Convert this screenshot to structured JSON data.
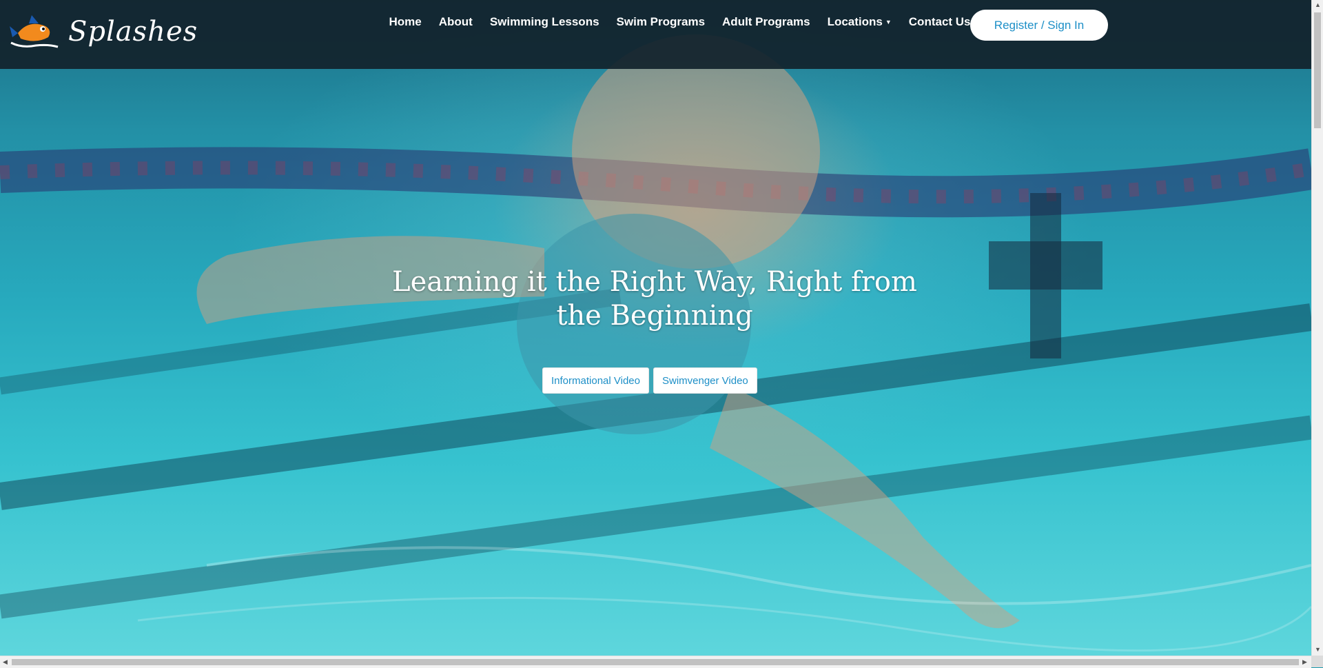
{
  "brand": {
    "name": "Splashes",
    "logo_icon": "fish-mascot-icon"
  },
  "nav": {
    "items": [
      {
        "label": "Home"
      },
      {
        "label": "About"
      },
      {
        "label": "Swimming Lessons"
      },
      {
        "label": "Swim Programs"
      },
      {
        "label": "Adult Programs"
      },
      {
        "label": "Locations",
        "has_dropdown": true
      },
      {
        "label": "Contact Us"
      }
    ],
    "register_label": "Register / Sign In"
  },
  "hero": {
    "headline": "Learning it the Right Way, Right from the Beginning",
    "buttons": [
      {
        "label": "Informational Video"
      },
      {
        "label": "Swimvenger Video"
      }
    ]
  },
  "colors": {
    "nav_bg": "#12222c",
    "accent": "#1d8fc7",
    "water": "#27a9bd"
  }
}
